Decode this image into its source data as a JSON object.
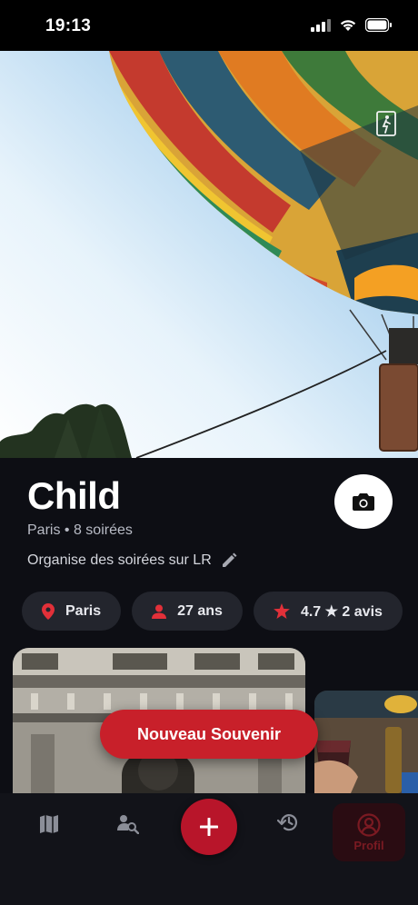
{
  "status_bar": {
    "time": "19:13"
  },
  "profile": {
    "name": "Child",
    "meta": "Paris • 8 soirées",
    "bio": "Organise des soirées sur LR"
  },
  "chips": [
    {
      "icon": "location-pin-icon",
      "label": "Paris"
    },
    {
      "icon": "person-icon",
      "label": "27 ans"
    },
    {
      "icon": "star-icon",
      "label": "4.7 ★ 2 avis"
    }
  ],
  "actions": {
    "new_memory": "Nouveau Souvenir"
  },
  "bottom_nav": {
    "items": [
      {
        "icon": "map-icon"
      },
      {
        "icon": "user-search-icon"
      },
      {
        "icon": "plus-icon"
      },
      {
        "icon": "history-icon"
      },
      {
        "icon": "profile-icon",
        "label": "Profil",
        "active": true
      }
    ]
  },
  "colors": {
    "accent": "#c8202a",
    "background": "#0d0e14",
    "chip": "#23252d"
  }
}
